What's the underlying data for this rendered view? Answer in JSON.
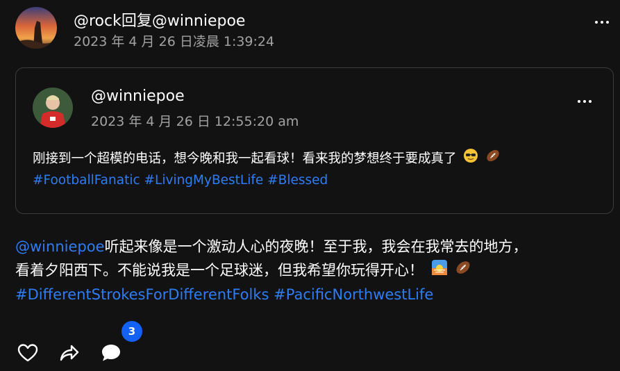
{
  "post": {
    "author_line": "@rock回复@winniepoe",
    "timestamp": "2023 年 4 月 26 日凌晨 1:39:24",
    "mention": "@winniepoe",
    "text_line1": "听起来像是一个激动人心的夜晚！至于我，我会在我常去的地方，",
    "text_line2": "看着夕阳西下。不能说我是一个足球迷，但我希望你玩得开心！",
    "hashtags": [
      "#DifferentStrokesForDifferentFolks",
      "#PacificNorthwestLife"
    ],
    "emojis": [
      "sunrise-emoji",
      "football-emoji"
    ]
  },
  "quoted_post": {
    "author": "@winniepoe",
    "timestamp": "2023 年 4 月 26 日 12:55:20 am",
    "text": "刚接到一个超模的电话，想今晚和我一起看球！看来我的梦想终于要成真了",
    "hashtags": [
      "#FootballFanatic",
      "#LivingMyBestLife",
      "#Blessed"
    ],
    "emojis": [
      "sunglasses-emoji",
      "football-emoji"
    ]
  },
  "actions": {
    "icons": [
      "heart-icon",
      "share-icon",
      "comment-icon"
    ],
    "comment_count": "3"
  },
  "colors": {
    "background": "#121212",
    "text": "#ffffff",
    "muted": "#a3a3a3",
    "link": "#2d7df6",
    "badge": "#1462f5",
    "card_border": "#3d3d3d"
  }
}
